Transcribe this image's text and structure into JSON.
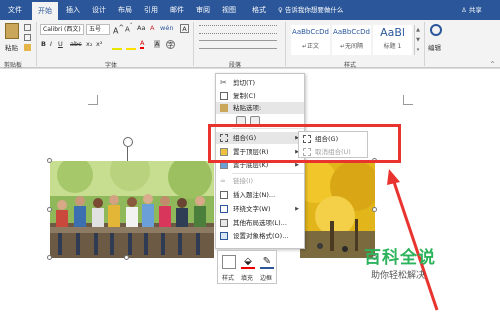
{
  "tabs": [
    {
      "label": "文件",
      "active": false
    },
    {
      "label": "开始",
      "active": true
    },
    {
      "label": "插入",
      "active": false
    },
    {
      "label": "设计",
      "active": false
    },
    {
      "label": "布局",
      "active": false
    },
    {
      "label": "引用",
      "active": false
    },
    {
      "label": "邮件",
      "active": false
    },
    {
      "label": "审阅",
      "active": false
    },
    {
      "label": "视图",
      "active": false
    },
    {
      "label": "格式",
      "active": false
    }
  ],
  "tell_me": "告诉我你想要做什么",
  "share": "共享",
  "ribbon": {
    "paste_label": "粘贴",
    "font_name": "Calibri (西文)",
    "font_size": "五号",
    "font_size_box": "wén",
    "styles": [
      {
        "sample": "AaBbCcDd",
        "name": "↵正文"
      },
      {
        "sample": "AaBbCcDd",
        "name": "↵无间隔"
      },
      {
        "sample": "AaBl",
        "name": "标题 1"
      }
    ],
    "edit_label": "编辑",
    "groups": {
      "clipboard": "剪贴板",
      "font": "字体",
      "paragraph": "段落",
      "styles": "样式"
    }
  },
  "context_menu": {
    "items": [
      {
        "label": "剪切(T)",
        "icon": "scissors-icon",
        "state": "normal"
      },
      {
        "label": "复制(C)",
        "icon": "copy-icon",
        "state": "normal"
      },
      {
        "label": "粘贴选项:",
        "icon": "paste-icon",
        "state": "normal"
      },
      {
        "label": "组合(G)",
        "icon": "group-icon",
        "state": "highlighted",
        "submenu": true
      },
      {
        "label": "置于顶层(R)",
        "icon": "bring-front-icon",
        "state": "normal",
        "submenu": true
      },
      {
        "label": "置于底层(K)",
        "icon": "send-back-icon",
        "state": "normal",
        "submenu": true
      },
      {
        "label": "链接(I)",
        "icon": "link-icon",
        "state": "disabled"
      },
      {
        "label": "插入题注(N)...",
        "icon": "caption-icon",
        "state": "normal"
      },
      {
        "label": "环绕文字(W)",
        "icon": "wrap-text-icon",
        "state": "normal",
        "submenu": true
      },
      {
        "label": "其他布局选项(L)...",
        "icon": "layout-icon",
        "state": "normal"
      },
      {
        "label": "设置对象格式(O)...",
        "icon": "format-icon",
        "state": "normal"
      }
    ]
  },
  "submenu": {
    "items": [
      {
        "label": "组合(G)",
        "state": "normal"
      },
      {
        "label": "取消组合(U)",
        "state": "disabled"
      }
    ]
  },
  "mini_toolbar": {
    "style_label": "样式",
    "fill_label": "填充",
    "border_label": "边框"
  },
  "watermark": {
    "title": "百科全说",
    "subtitle": "助你轻松解决"
  },
  "colors": {
    "ribbon_blue": "#2b579a",
    "highlight_red": "#e8332e",
    "watermark_green": "#2db35b"
  }
}
